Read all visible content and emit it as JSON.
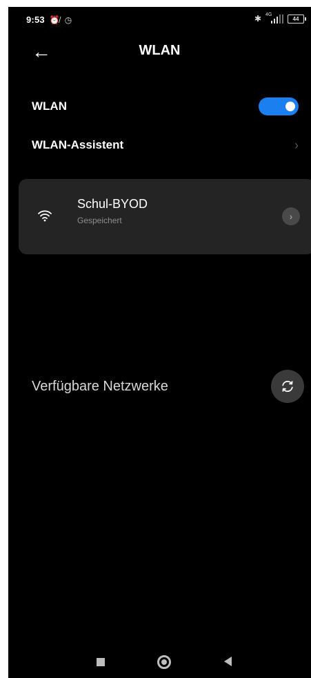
{
  "status_bar": {
    "time": "9:53",
    "icons_left": [
      "alarm-off-icon",
      "alarm-clock-icon"
    ],
    "network_tag": "4G",
    "battery": "44",
    "icons_right": [
      "bluetooth-icon",
      "signal-icon",
      "battery-icon"
    ]
  },
  "header": {
    "title": "WLAN",
    "back_icon": "back-arrow-icon"
  },
  "wlan_toggle": {
    "label": "WLAN",
    "enabled": true,
    "accent": "#1b7ff0"
  },
  "assistant": {
    "label": "WLAN-Assistent"
  },
  "saved_network": {
    "ssid": "Schul-BYOD",
    "status": "Gespeichert",
    "icon": "wifi-icon"
  },
  "available": {
    "label": "Verfügbare Netzwerke",
    "refresh_icon": "refresh-icon"
  },
  "nav_bar": {
    "buttons": [
      "recents-button",
      "home-button",
      "back-button"
    ]
  }
}
